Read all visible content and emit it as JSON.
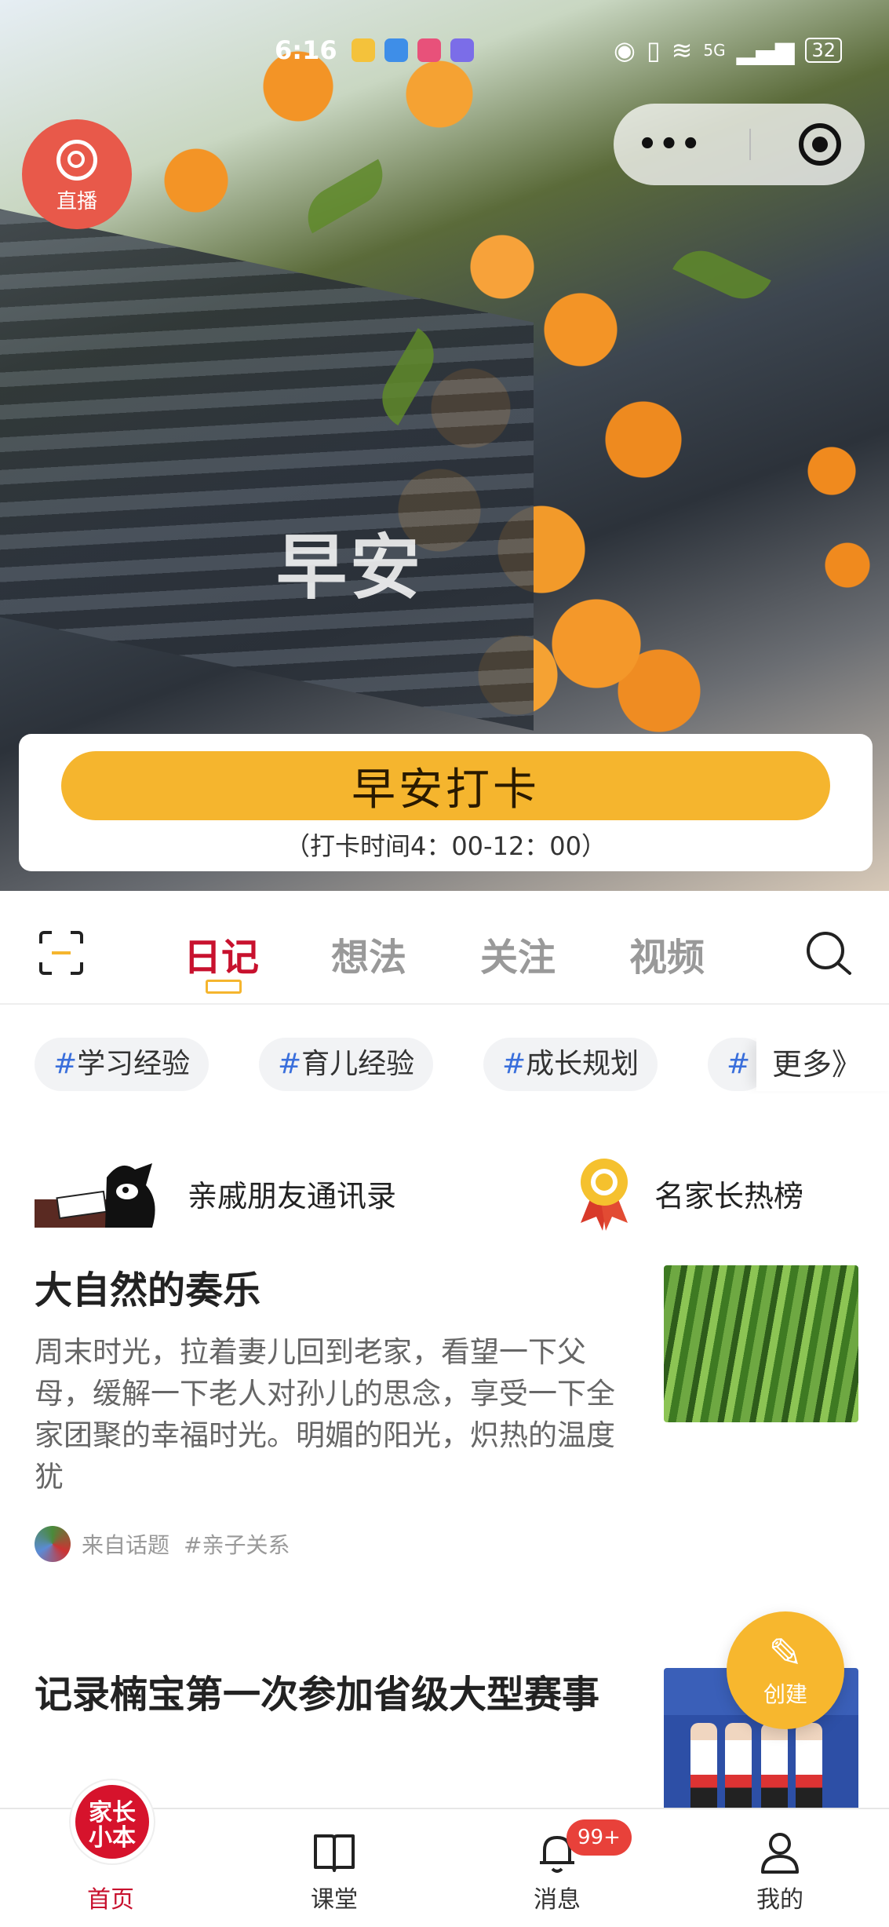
{
  "status_bar": {
    "time": "6:16",
    "network": "5G",
    "battery": "32"
  },
  "live": {
    "label": "直播"
  },
  "hero": {
    "greeting": "早安"
  },
  "checkin": {
    "button_label": "早安打卡",
    "time_text": "（打卡时间4：00-12：00）"
  },
  "tabs": [
    {
      "label": "日记",
      "active": true
    },
    {
      "label": "想法",
      "active": false
    },
    {
      "label": "关注",
      "active": false
    },
    {
      "label": "视频",
      "active": false
    }
  ],
  "hashtags": [
    {
      "hash": "#",
      "label": "学习经验"
    },
    {
      "hash": "#",
      "label": "育儿经验"
    },
    {
      "hash": "#",
      "label": "成长规划"
    },
    {
      "hash": "#",
      "label": ""
    }
  ],
  "more_label": "更多》",
  "quick_links": [
    {
      "label": "亲戚朋友通讯录",
      "icon": "dog-reading-icon"
    },
    {
      "label": "名家长热榜",
      "icon": "medal-icon"
    }
  ],
  "posts": [
    {
      "title": "大自然的奏乐",
      "excerpt": "周末时光，拉着妻儿回到老家，看望一下父母，缓解一下老人对孙儿的思念，享受一下全家团聚的幸福时光。明媚的阳光，炽热的温度犹",
      "source": "来自话题",
      "topic": "#亲子关系",
      "thumb": "bamboo-photo"
    },
    {
      "title": "记录楠宝第一次参加省级大型赛事",
      "thumb": "kids-award-photo"
    }
  ],
  "create_button": {
    "label": "创建"
  },
  "bottom_nav": [
    {
      "label": "首页",
      "icon": "home-logo",
      "active": true
    },
    {
      "label": "课堂",
      "icon": "book-icon",
      "active": false
    },
    {
      "label": "消息",
      "icon": "bell-icon",
      "active": false,
      "badge": "99+"
    },
    {
      "label": "我的",
      "icon": "user-icon",
      "active": false
    }
  ],
  "home_logo": {
    "line1": "家长",
    "line2": "小本"
  },
  "colors": {
    "accent_red": "#c8112e",
    "checkin_yellow": "#f5b52e",
    "hashtag_blue": "#3a6fdc"
  }
}
